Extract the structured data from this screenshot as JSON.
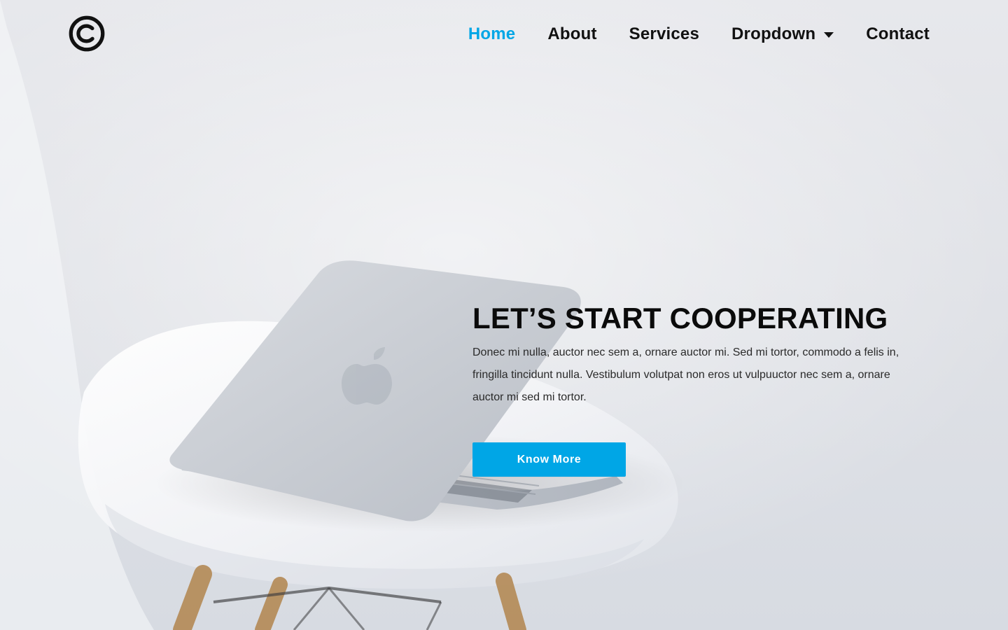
{
  "brand": {
    "logo_icon": "copyright-icon"
  },
  "nav": {
    "items": [
      {
        "label": "Home"
      },
      {
        "label": "About"
      },
      {
        "label": "Services"
      },
      {
        "label": "Dropdown"
      },
      {
        "label": "Contact"
      }
    ],
    "active_index": 0,
    "dropdown_icon": "caret-down-icon"
  },
  "hero": {
    "title": "LET’S START COOPERATING",
    "body": "Donec mi nulla, auctor nec sem a, ornare auctor mi. Sed mi tortor, commodo a felis in, fringilla tincidunt nulla. Vestibulum volutpat non eros ut vulpuuctor nec sem a, ornare auctor mi sed mi tortor.",
    "cta_label": "Know More"
  },
  "colors": {
    "accent": "#00a6e6",
    "nav_text": "#111111",
    "background": "#e7e8ec"
  }
}
